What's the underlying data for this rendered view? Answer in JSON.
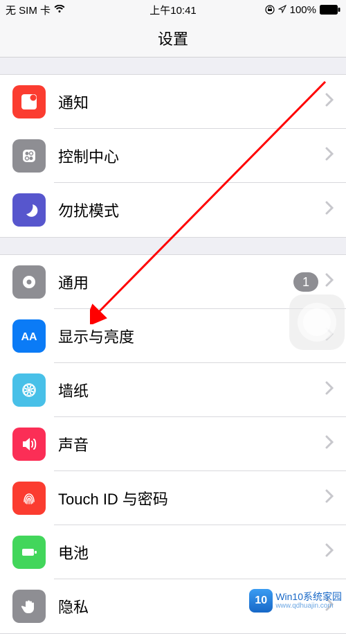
{
  "status": {
    "left": "无 SIM 卡",
    "time": "上午10:41",
    "battery": "100%"
  },
  "title": "设置",
  "groups": [
    {
      "items": [
        {
          "id": "notifications",
          "label": "通知"
        },
        {
          "id": "control-center",
          "label": "控制中心"
        },
        {
          "id": "dnd",
          "label": "勿扰模式"
        }
      ]
    },
    {
      "items": [
        {
          "id": "general",
          "label": "通用",
          "badge": "1"
        },
        {
          "id": "display",
          "label": "显示与亮度"
        },
        {
          "id": "wallpaper",
          "label": "墙纸"
        },
        {
          "id": "sounds",
          "label": "声音"
        },
        {
          "id": "touchid",
          "label": "Touch ID 与密码"
        },
        {
          "id": "battery",
          "label": "电池"
        },
        {
          "id": "privacy",
          "label": "隐私"
        }
      ]
    }
  ],
  "watermark": {
    "logo": "10",
    "title": "Win10系统家园",
    "sub": "www.qdhuajin.com"
  }
}
